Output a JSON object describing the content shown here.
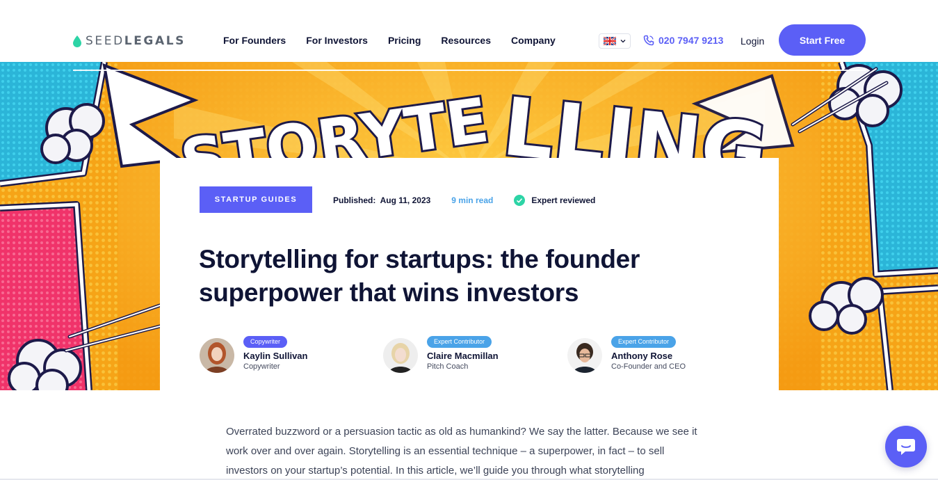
{
  "brand": {
    "name_part1": "SEED",
    "name_part2": "LEGALS",
    "accent_color": "#5b5ff6",
    "drop_color": "#2dd4a6"
  },
  "nav": {
    "items": [
      {
        "label": "For Founders"
      },
      {
        "label": "For Investors"
      },
      {
        "label": "Pricing"
      },
      {
        "label": "Resources"
      },
      {
        "label": "Company"
      }
    ]
  },
  "header": {
    "language_icon": "uk-flag-icon",
    "phone": "020 7947 9213",
    "login": "Login",
    "cta": "Start Free"
  },
  "hero": {
    "background_text": "STORYTELLING"
  },
  "article": {
    "category": "STARTUP GUIDES",
    "published_label": "Published:",
    "published_date": "Aug 11, 2023",
    "read_time": "9 min read",
    "reviewed": "Expert reviewed",
    "title": "Storytelling for startups: the founder superpower that wins investors",
    "authors": [
      {
        "badge": "Copywriter",
        "badge_color": "#5b5ff6",
        "name": "Kaylin Sullivan",
        "role": "Copywriter"
      },
      {
        "badge": "Expert Contributor",
        "badge_color": "#4aa3e8",
        "name": "Claire Macmillan",
        "role": "Pitch Coach"
      },
      {
        "badge": "Expert Contributor",
        "badge_color": "#4aa3e8",
        "name": "Anthony Rose",
        "role": "Co-Founder and CEO"
      }
    ],
    "intro": "Overrated buzzword or a persuasion tactic as old as humankind? We say the latter. Because we see it work over and over again. Storytelling is an essential technique – a superpower, in fact – to sell investors on your startup’s potential. In this article, we’ll guide you through what storytelling"
  },
  "chat": {
    "icon": "chat-bubble-icon"
  }
}
